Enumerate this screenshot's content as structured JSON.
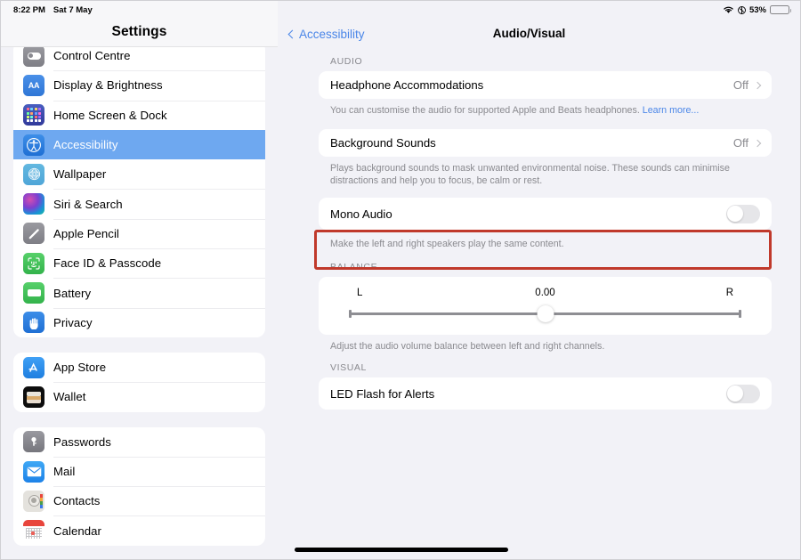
{
  "status_bar": {
    "time": "8:22 PM",
    "date": "Sat 7 May",
    "battery_percent": "53%",
    "wifi_icon": "wifi-icon",
    "orientation_lock_icon": "rotation-lock-icon",
    "battery_icon": "battery-icon",
    "battery_level": 53
  },
  "sidebar": {
    "title": "Settings",
    "groups": [
      {
        "items": [
          {
            "label": "Control Centre",
            "icon": "control-centre-icon",
            "selected": false,
            "clipped": true
          },
          {
            "label": "Display & Brightness",
            "icon": "display-brightness-icon",
            "selected": false
          },
          {
            "label": "Home Screen & Dock",
            "icon": "home-screen-dock-icon",
            "selected": false
          },
          {
            "label": "Accessibility",
            "icon": "accessibility-icon",
            "selected": true
          },
          {
            "label": "Wallpaper",
            "icon": "wallpaper-icon",
            "selected": false
          },
          {
            "label": "Siri & Search",
            "icon": "siri-search-icon",
            "selected": false
          },
          {
            "label": "Apple Pencil",
            "icon": "apple-pencil-icon",
            "selected": false
          },
          {
            "label": "Face ID & Passcode",
            "icon": "face-id-icon",
            "selected": false
          },
          {
            "label": "Battery",
            "icon": "battery-settings-icon",
            "selected": false
          },
          {
            "label": "Privacy",
            "icon": "privacy-icon",
            "selected": false
          }
        ]
      },
      {
        "items": [
          {
            "label": "App Store",
            "icon": "app-store-icon",
            "selected": false
          },
          {
            "label": "Wallet",
            "icon": "wallet-icon",
            "selected": false
          }
        ]
      },
      {
        "items": [
          {
            "label": "Passwords",
            "icon": "passwords-icon",
            "selected": false
          },
          {
            "label": "Mail",
            "icon": "mail-icon",
            "selected": false
          },
          {
            "label": "Contacts",
            "icon": "contacts-icon",
            "selected": false
          },
          {
            "label": "Calendar",
            "icon": "calendar-icon",
            "selected": false
          }
        ]
      }
    ],
    "selected_accent_color": "#6ea8f0"
  },
  "main": {
    "back_label": "Accessibility",
    "title": "Audio/Visual",
    "sections": {
      "audio": {
        "label": "AUDIO",
        "headphone_accommodations": {
          "label": "Headphone Accommodations",
          "value": "Off",
          "footnote": "You can customise the audio for supported Apple and Beats headphones. ",
          "footnote_link": "Learn more..."
        },
        "background_sounds": {
          "label": "Background Sounds",
          "value": "Off",
          "footnote": "Plays background sounds to mask unwanted environmental noise. These sounds can minimise distractions and help you to focus, be calm or rest."
        },
        "mono_audio": {
          "label": "Mono Audio",
          "toggle_state": "off",
          "footnote": "Make the left and right speakers play the same content."
        }
      },
      "balance": {
        "label": "BALANCE",
        "left_label": "L",
        "right_label": "R",
        "value": "0.00",
        "slider_position_percent": 50,
        "footnote": "Adjust the audio volume balance between left and right channels."
      },
      "visual": {
        "label": "VISUAL",
        "led_flash_for_alerts": {
          "label": "LED Flash for Alerts",
          "toggle_state": "off"
        }
      }
    }
  },
  "annotation": {
    "color": "#c0392b",
    "target": "mono-audio-row"
  }
}
